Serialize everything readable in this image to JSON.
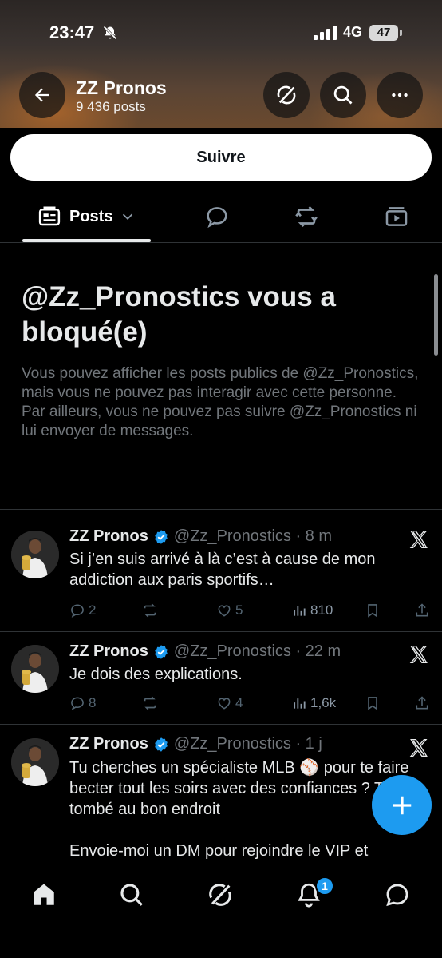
{
  "status_bar": {
    "time": "23:47",
    "network": "4G",
    "battery": "47"
  },
  "header": {
    "name": "ZZ Pronos",
    "posts_count": "9 436 posts"
  },
  "follow_button": {
    "label": "Suivre"
  },
  "tabs": {
    "posts_label": "Posts"
  },
  "blocked": {
    "title": "@Zz_Pronostics vous a bloqué(e)",
    "description": "Vous pouvez afficher les posts publics de @Zz_Pronostics, mais vous ne pouvez pas interagir avec cette personne. Par ailleurs, vous ne pouvez pas suivre @Zz_Pronostics ni lui envoyer de messages."
  },
  "tweets": [
    {
      "name": "ZZ Pronos",
      "handle_time": "@Zz_Pronostics · 8 m",
      "text": "Si j’en suis arrivé à là c’est à cause de mon addiction aux paris sportifs…",
      "replies": "2",
      "reposts": "",
      "likes": "5",
      "views": "810"
    },
    {
      "name": "ZZ Pronos",
      "handle_time": "@Zz_Pronostics · 22 m",
      "text": "Je dois des explications.",
      "replies": "8",
      "reposts": "",
      "likes": "4",
      "views": "1,6k"
    },
    {
      "name": "ZZ Pronos",
      "handle_time": "@Zz_Pronostics · 1 j",
      "text": "Tu cherches un spécialiste MLB ⚾ pour te faire becter tout les soirs avec des confiances ? T’es tombé au bon endroit\n\nEnvoie-moi un DM pour rejoindre le VIP et"
    }
  ],
  "bottom_nav": {
    "notification_count": "1"
  },
  "colors": {
    "accent": "#1d9bf0",
    "muted": "#71767b",
    "background": "#000000"
  }
}
